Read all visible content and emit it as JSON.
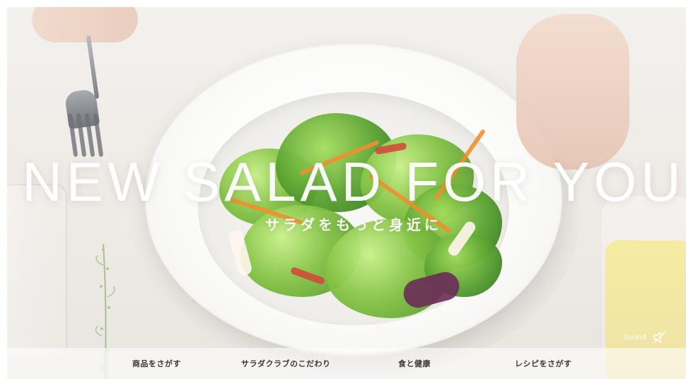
{
  "hero": {
    "title": "NEW SALAD FOR YOU",
    "subtitle": "サラダをもっと身近に",
    "sound_label": "Sound"
  },
  "nav": {
    "items": [
      {
        "label": "商品をさがす"
      },
      {
        "label": "サラダクラブのこだわり"
      },
      {
        "label": "食と健康"
      },
      {
        "label": "レシピをさがす"
      }
    ]
  },
  "icons": {
    "sound": "speaker-muted-icon"
  },
  "colors": {
    "overlay_text": "#ffffff",
    "nav_text": "#3a3a3a"
  }
}
